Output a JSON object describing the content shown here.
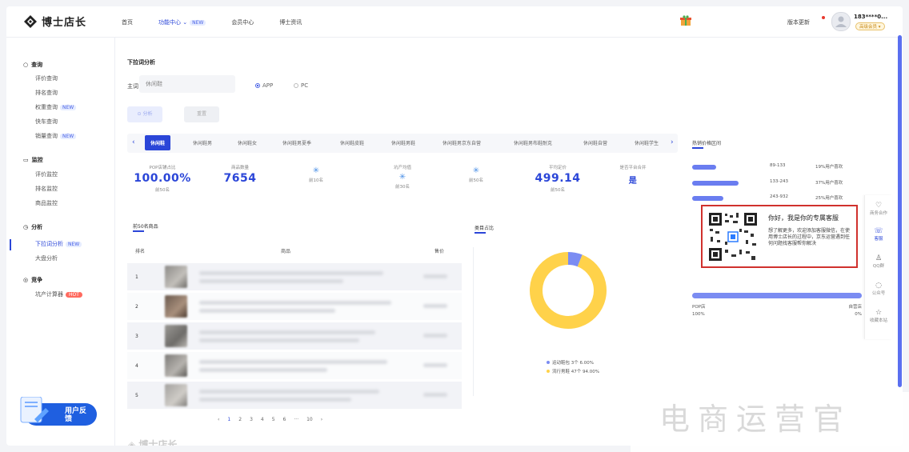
{
  "header": {
    "brand": "博士店长",
    "nav": [
      {
        "label": "首页"
      },
      {
        "label": "功能中心 ⌄",
        "badge": "NEW"
      },
      {
        "label": "会员中心"
      },
      {
        "label": "博士资讯"
      }
    ],
    "version_update": "版本更新",
    "user_phone": "183****0...",
    "user_tag": "高级会员 ▾"
  },
  "sidebar": {
    "groups": [
      {
        "title": "查询",
        "icon": "search-icon",
        "items": [
          {
            "label": "评价查询"
          },
          {
            "label": "排名查询"
          },
          {
            "label": "权重查询",
            "tag": "NEW"
          },
          {
            "label": "快车查询"
          },
          {
            "label": "销量查询",
            "tag": "NEW"
          }
        ]
      },
      {
        "title": "监控",
        "icon": "monitor-icon",
        "items": [
          {
            "label": "评价监控"
          },
          {
            "label": "排名监控"
          },
          {
            "label": "商品监控"
          }
        ]
      },
      {
        "title": "分析",
        "icon": "clock-icon",
        "items": [
          {
            "label": "下拉词分析",
            "tag": "NEW",
            "active": true
          },
          {
            "label": "大盘分析"
          }
        ]
      },
      {
        "title": "竞争",
        "icon": "compete-icon",
        "items": [
          {
            "label": "坑产计算器",
            "hot": "HOT"
          }
        ]
      }
    ],
    "feedback": "用户反馈"
  },
  "main": {
    "title": "下拉词分析",
    "keyword_label": "主词",
    "keyword_value": "休闲鞋",
    "platform_options": [
      "APP",
      "PC"
    ],
    "platform_selected": "APP",
    "analyze_button": "分析",
    "reset_button": "重置",
    "tabs": [
      "休闲鞋",
      "休闲鞋男",
      "休闲鞋女",
      "休闲鞋男夏季",
      "休闲鞋皮鞋",
      "休闲鞋男鞋",
      "休闲鞋男京东自营",
      "休闲鞋男布鞋耐克",
      "休闲鞋自营",
      "休闲鞋学生"
    ],
    "stats": [
      {
        "label": "POP店铺占比",
        "value": "100.00%",
        "sub": "前50名"
      },
      {
        "label": "商品数量",
        "value": "7654",
        "sub": ""
      },
      {
        "label": "",
        "value": "",
        "sub": "前10名",
        "loading": true
      },
      {
        "label": "坑产均值",
        "value": "",
        "sub": "前30名",
        "loading": true
      },
      {
        "label": "",
        "value": "",
        "sub": "前50名",
        "loading": true
      },
      {
        "label": "平均定价",
        "value": "499.14",
        "sub": "前50名"
      },
      {
        "label": "是否平台合并",
        "value": "是",
        "sub": ""
      }
    ],
    "top_products_title": "前50名商品",
    "table_headers": {
      "rank": "排名",
      "product": "商品",
      "price": "售价"
    },
    "ranks": [
      "1",
      "2",
      "3",
      "4",
      "5"
    ],
    "pager": [
      "‹",
      "1",
      "2",
      "3",
      "4",
      "5",
      "6",
      "···",
      "10",
      "›"
    ],
    "category_title": "类目占比",
    "category_legend": [
      {
        "label": "运动鞋包 3个 6.00%",
        "color": "#7b8cf2",
        "share": 6
      },
      {
        "label": "流行男鞋 47个 94.00%",
        "color": "#ffd24a",
        "share": 94
      }
    ],
    "price_title": "热销价格区间",
    "price_ranges": [
      {
        "range": "89-133",
        "pct": "19%用户喜欢",
        "share": 19
      },
      {
        "range": "133-243",
        "pct": "37%用户喜欢",
        "share": 37
      },
      {
        "range": "243-932",
        "pct": "25%用户喜欢",
        "share": 25
      }
    ],
    "shop_type": {
      "left_label": "POP店",
      "right_label": "自营店",
      "left_value": "100%",
      "right_value": "0%",
      "share": 100
    },
    "bottom_brand": "博士店长"
  },
  "popup": {
    "title": "你好，我是你的专属客服",
    "body": "想了解更多，欢迎添加客服微信，在使用博士店长的过程中，京东运营遇到任何问题找客服帮你解决"
  },
  "floatbar": [
    {
      "label": "商务合作",
      "icon": "handshake-icon"
    },
    {
      "label": "客服",
      "icon": "headset-icon",
      "active": true
    },
    {
      "label": "QQ群",
      "icon": "qq-icon"
    },
    {
      "label": "公众号",
      "icon": "chat-icon"
    },
    {
      "label": "收藏本站",
      "icon": "star-icon"
    }
  ],
  "watermark": "电商运营官",
  "colors": {
    "accent": "#2b46d8",
    "donut_yellow": "#ffd24a",
    "donut_blue": "#7b8cf2",
    "hot": "#ff6a5f",
    "popup_border": "#d0312d"
  }
}
